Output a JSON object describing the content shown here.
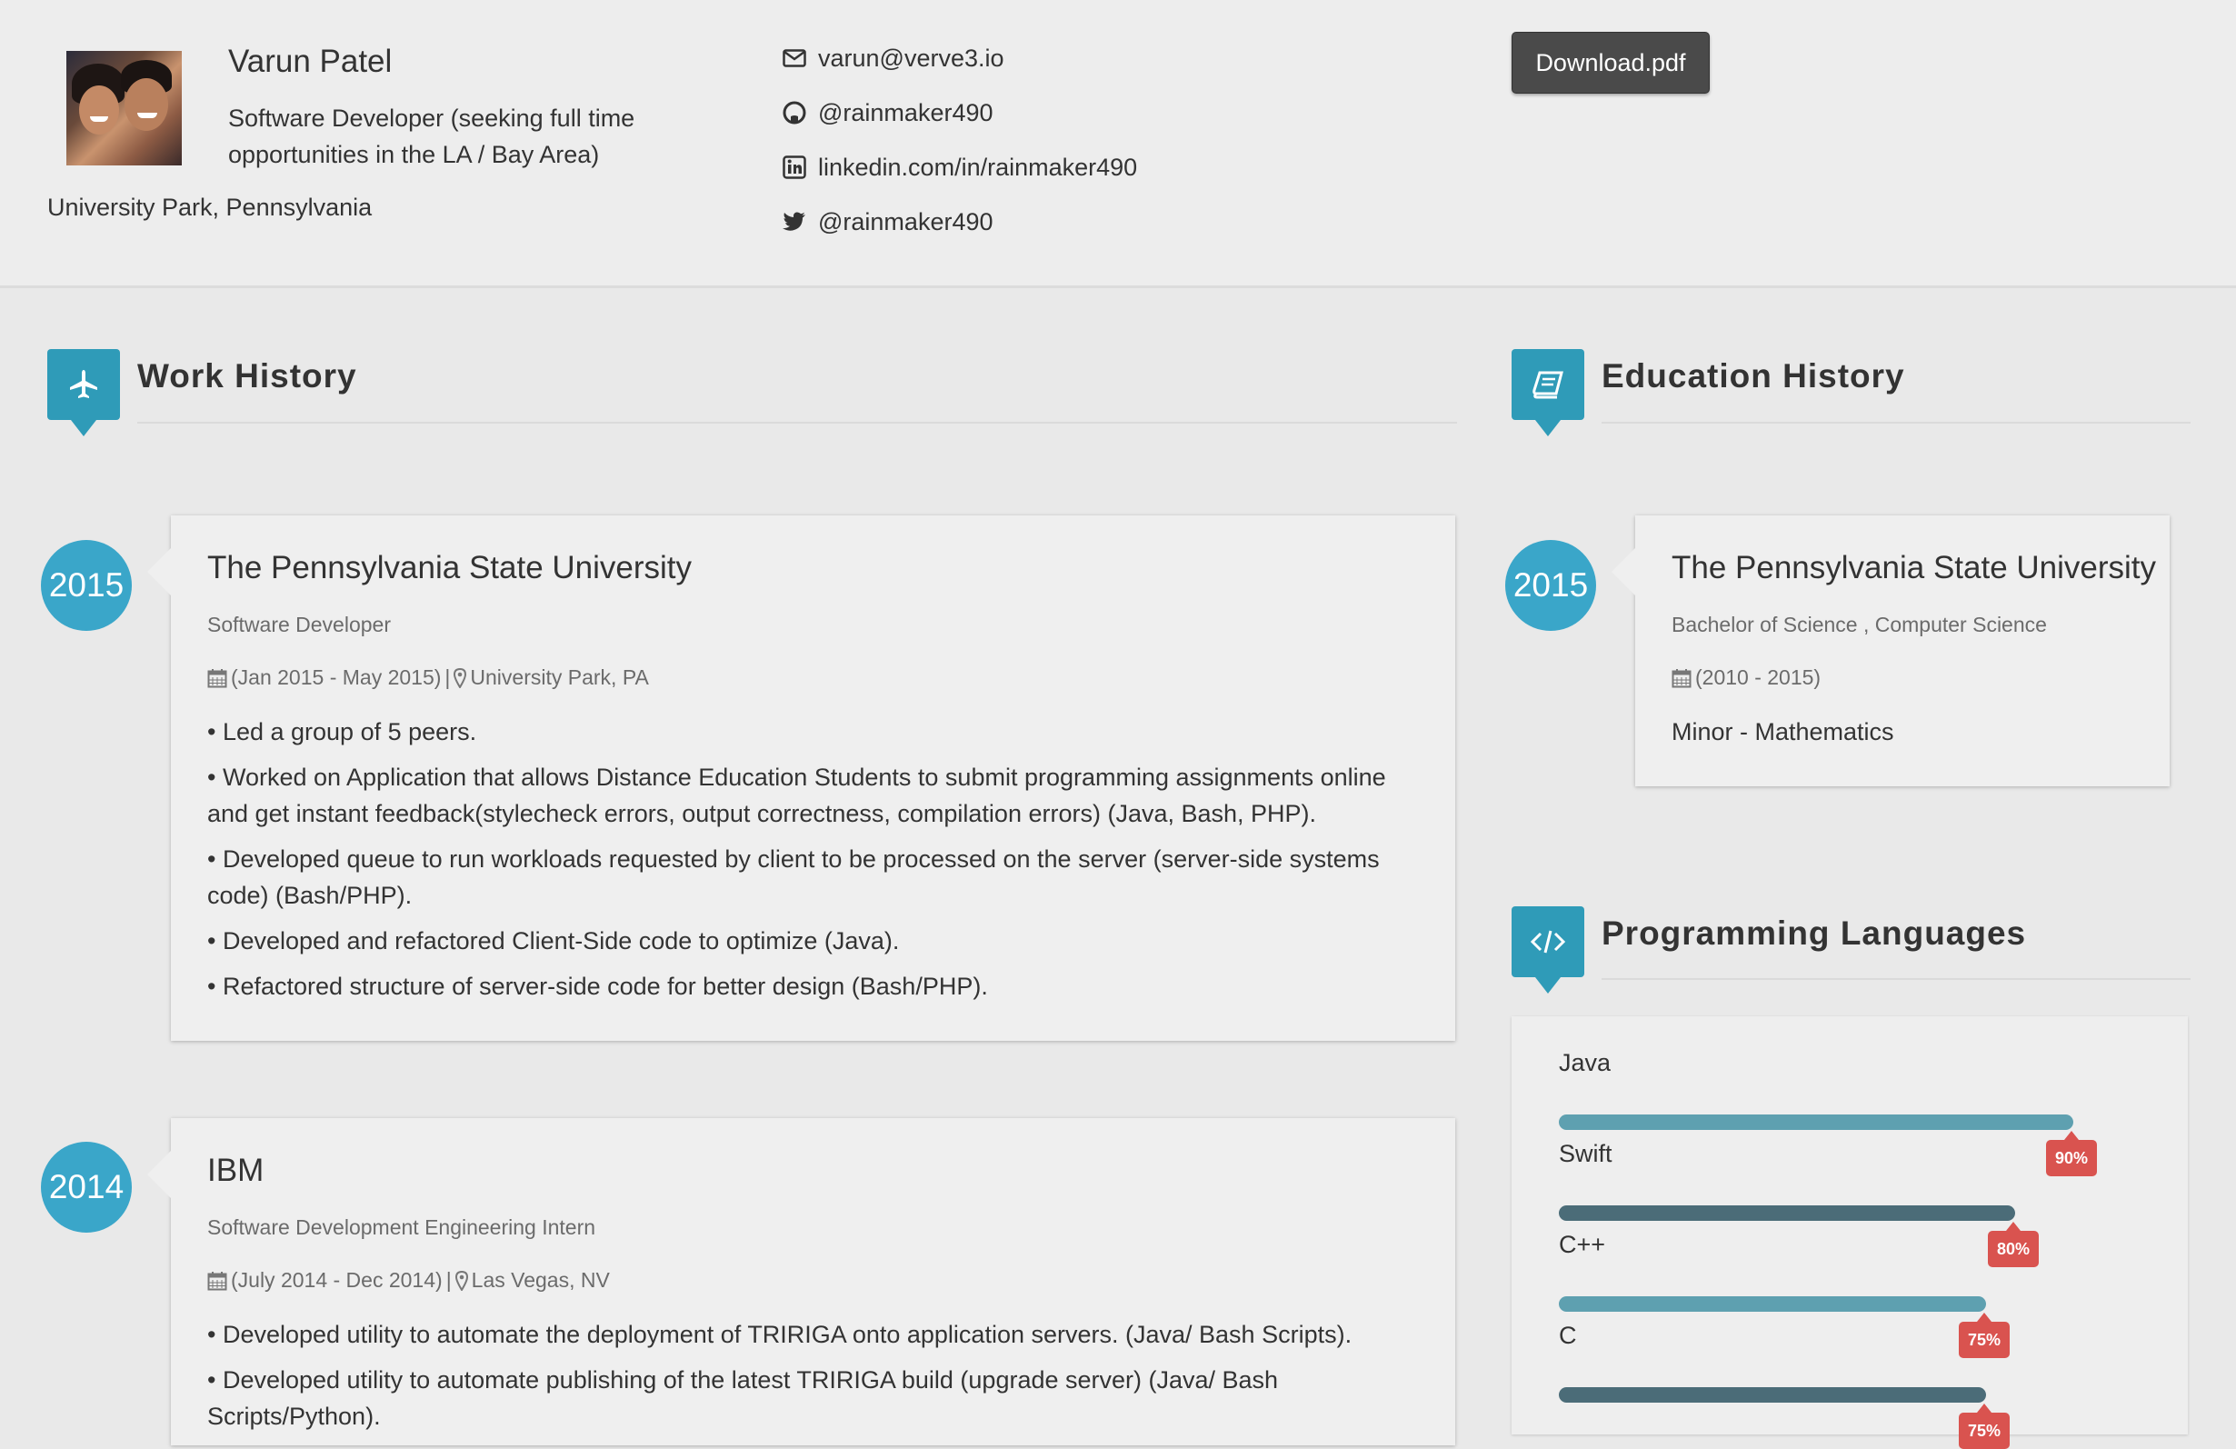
{
  "profile": {
    "name": "Varun Patel",
    "tagline": "Software Developer (seeking full time opportunities in the LA / Bay Area)",
    "location": "University Park, Pennsylvania"
  },
  "contacts": [
    {
      "icon": "envelope-icon",
      "text": "varun@verve3.io"
    },
    {
      "icon": "github-icon",
      "text": "@rainmaker490"
    },
    {
      "icon": "linkedin-icon",
      "text": "linkedin.com/in/rainmaker490"
    },
    {
      "icon": "twitter-icon",
      "text": "@rainmaker490"
    }
  ],
  "download_label": "Download.pdf",
  "work": {
    "title": "Work History",
    "icon": "airplane-icon",
    "jobs": [
      {
        "year": "2015",
        "company": "The Pennsylvania State University",
        "role": "Software Developer",
        "dates": "(Jan 2015 - May 2015)",
        "separator": "|",
        "place": "University Park, PA",
        "bullets": [
          "• Led a group of 5 peers.",
          "• Worked on Application that allows Distance Education Students to submit programming assignments online and get instant feedback(stylecheck errors, output correctness, compilation errors) (Java, Bash, PHP).",
          "• Developed queue to run workloads requested by client to be processed on the server (server-side systems code) (Bash/PHP).",
          "• Developed and refactored Client-Side code to optimize (Java).",
          "• Refactored structure of server-side code for better design (Bash/PHP)."
        ]
      },
      {
        "year": "2014",
        "company": "IBM",
        "role": "Software Development Engineering Intern",
        "dates": "(July 2014 - Dec 2014)",
        "separator": "|",
        "place": "Las Vegas, NV",
        "bullets": [
          "• Developed utility to automate the deployment of TRIRIGA onto application servers. (Java/ Bash Scripts).",
          "• Developed utility to automate publishing of the latest TRIRIGA build (upgrade server) (Java/ Bash Scripts/Python)."
        ]
      }
    ]
  },
  "education": {
    "title": "Education History",
    "icon": "book-icon",
    "year": "2015",
    "school": "The Pennsylvania State University",
    "degree": "Bachelor of Science , Computer Science",
    "dates": "(2010 - 2015)",
    "minor": "Minor - Mathematics"
  },
  "languages": {
    "title": "Programming Languages",
    "icon": "code-icon",
    "items": [
      {
        "name": "Java",
        "percent": 90,
        "label": "90%",
        "color": "#5ea0b0"
      },
      {
        "name": "Swift",
        "percent": 80,
        "label": "80%",
        "color": "#4b6c78"
      },
      {
        "name": "C++",
        "percent": 75,
        "label": "75%",
        "color": "#5ea0b0"
      },
      {
        "name": "C",
        "percent": 75,
        "label": "75%",
        "color": "#4b6c78"
      }
    ]
  },
  "colors": {
    "accent": "#2f9bb8",
    "year_circle": "#3aa6c9",
    "badge": "#d9534f"
  }
}
